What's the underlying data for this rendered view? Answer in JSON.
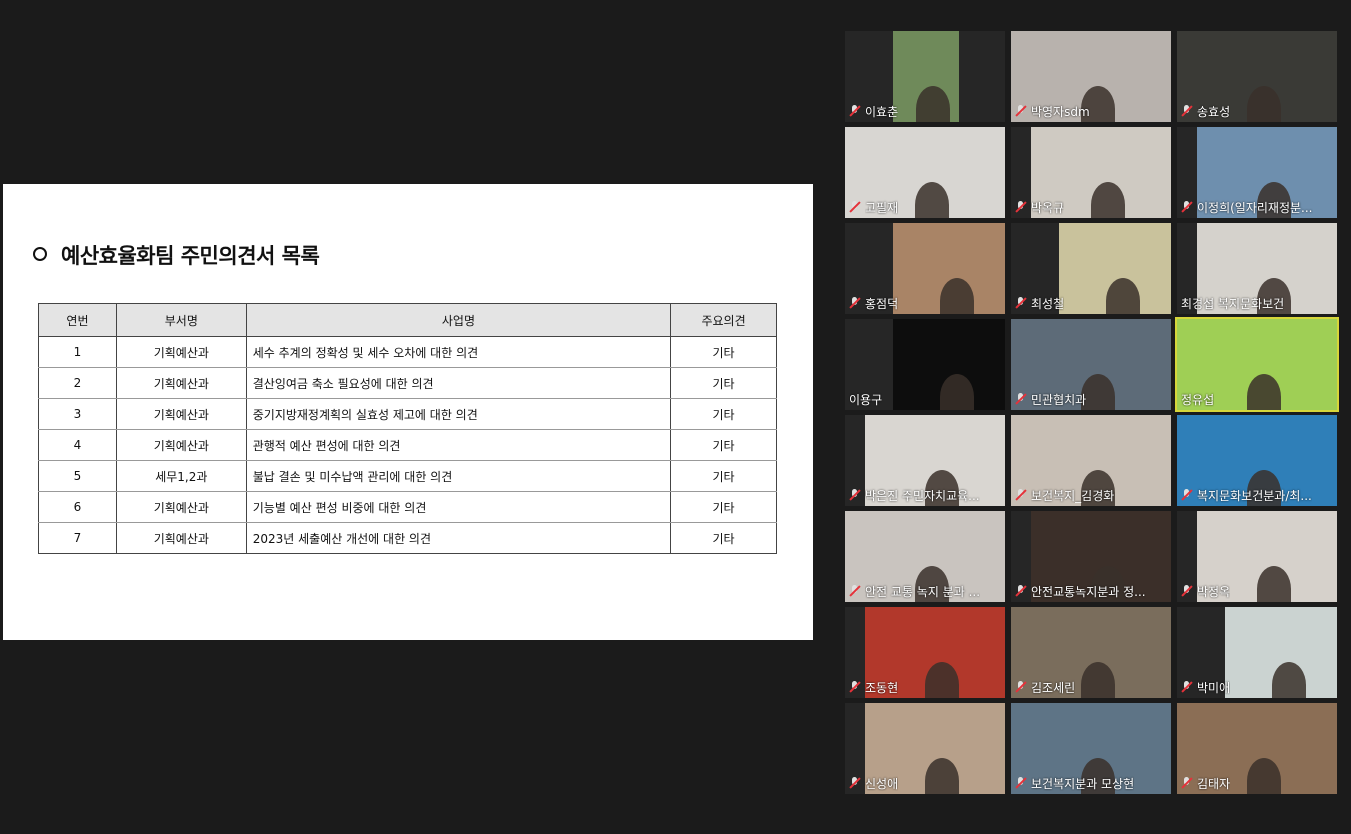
{
  "slide": {
    "title": "예산효율화팀 주민의견서 목록",
    "columns": [
      "연번",
      "부서명",
      "사업명",
      "주요의견"
    ],
    "rows": [
      [
        "1",
        "기획예산과",
        "세수 추계의 정확성 및 세수 오차에 대한 의견",
        "기타"
      ],
      [
        "2",
        "기획예산과",
        "결산잉여금 축소 필요성에 대한 의견",
        "기타"
      ],
      [
        "3",
        "기획예산과",
        "중기지방재정계획의 실효성 제고에 대한 의견",
        "기타"
      ],
      [
        "4",
        "기획예산과",
        "관행적 예산 편성에 대한 의견",
        "기타"
      ],
      [
        "5",
        "세무1,2과",
        "불납 결손 및 미수납액 관리에 대한 의견",
        "기타"
      ],
      [
        "6",
        "기획예산과",
        "기능별 예산 편성 비중에 대한 의견",
        "기타"
      ],
      [
        "7",
        "기획예산과",
        "2023년 세출예산 개선에 대한 의견",
        "기타"
      ]
    ]
  },
  "participants": [
    {
      "name": "이효춘",
      "muted": true,
      "bg": "#6f8a5a"
    },
    {
      "name": "박영자sdm",
      "muted": true,
      "bg": "#b8b2ad"
    },
    {
      "name": "송효성",
      "muted": true,
      "bg": "#3a3a36"
    },
    {
      "name": "고필재",
      "muted": true,
      "bg": "#d8d6d2"
    },
    {
      "name": "박옥규",
      "muted": true,
      "bg": "#cfcac2"
    },
    {
      "name": "이정희(일자리재정분...",
      "muted": true,
      "bg": "#6e8fae"
    },
    {
      "name": "홍점덕",
      "muted": true,
      "bg": "#a98466"
    },
    {
      "name": "최성철",
      "muted": true,
      "bg": "#c9c29c"
    },
    {
      "name": "최경섭 복지문화보건",
      "muted": false,
      "bg": "#d5d2cc"
    },
    {
      "name": "이용구",
      "muted": false,
      "bg": "#0d0d0d"
    },
    {
      "name": "민관협치과",
      "muted": true,
      "bg": "#5d6b78"
    },
    {
      "name": "정유섭",
      "muted": false,
      "bg": "#9fcf55",
      "active": true
    },
    {
      "name": "박은진 주민자치교육...",
      "muted": true,
      "bg": "#d9d6d1"
    },
    {
      "name": "보건복지_김경화",
      "muted": true,
      "bg": "#c8bfb5"
    },
    {
      "name": "복지문화보건분과/최...",
      "muted": true,
      "bg": "#2f7fb8"
    },
    {
      "name": "안전 교통 녹지 분과 ...",
      "muted": true,
      "bg": "#c9c4bf"
    },
    {
      "name": "안전교통녹지분과 정...",
      "muted": true,
      "bg": "#3b2f29"
    },
    {
      "name": "박정옥",
      "muted": true,
      "bg": "#d6d1cb"
    },
    {
      "name": "조동현",
      "muted": true,
      "bg": "#b2382b"
    },
    {
      "name": "김조세린",
      "muted": true,
      "bg": "#7a6d5c"
    },
    {
      "name": "박미애",
      "muted": true,
      "bg": "#cbd3d1"
    },
    {
      "name": "신성애",
      "muted": true,
      "bg": "#b7a08a"
    },
    {
      "name": "보건복지분과 모상현",
      "muted": true,
      "bg": "#5e7486"
    },
    {
      "name": "김태자",
      "muted": true,
      "bg": "#8b6e55"
    }
  ]
}
